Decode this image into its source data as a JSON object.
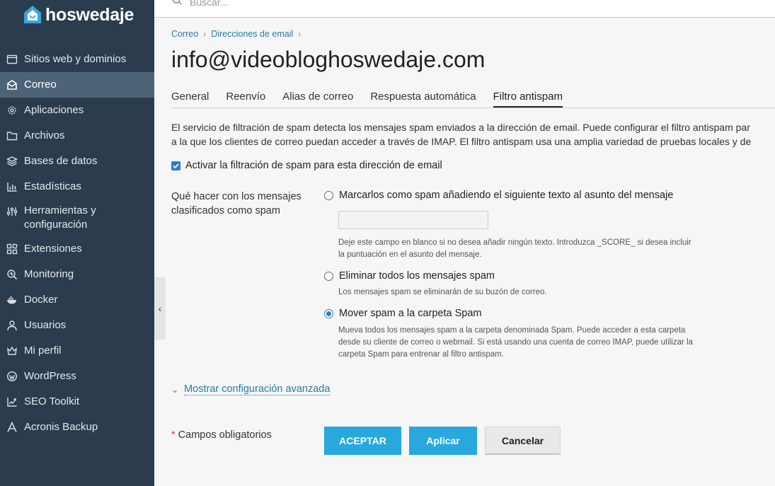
{
  "brand": {
    "name": "hoswedaje"
  },
  "search": {
    "placeholder": "Buscar..."
  },
  "sidebar": {
    "items": [
      {
        "label": "Sitios web y dominios",
        "icon": "globe-icon"
      },
      {
        "label": "Correo",
        "icon": "envelope-icon",
        "active": true
      },
      {
        "label": "Aplicaciones",
        "icon": "gear-icon"
      },
      {
        "label": "Archivos",
        "icon": "folder-icon"
      },
      {
        "label": "Bases de datos",
        "icon": "database-icon"
      },
      {
        "label": "Estadísticas",
        "icon": "bar-chart-icon"
      },
      {
        "label": "Herramientas y configuración",
        "icon": "tools-icon"
      },
      {
        "label": "Extensiones",
        "icon": "extensions-icon"
      },
      {
        "label": "Monitoring",
        "icon": "monitoring-icon"
      },
      {
        "label": "Docker",
        "icon": "docker-icon"
      },
      {
        "label": "Usuarios",
        "icon": "user-icon"
      },
      {
        "label": "Mi perfil",
        "icon": "crown-icon"
      },
      {
        "label": "WordPress",
        "icon": "wordpress-icon"
      },
      {
        "label": "SEO Toolkit",
        "icon": "seo-chart-icon"
      },
      {
        "label": "Acronis Backup",
        "icon": "acronis-icon"
      }
    ]
  },
  "breadcrumb": {
    "items": [
      "Correo",
      "Direcciones de email"
    ]
  },
  "page": {
    "title": "info@videobloghoswedaje.com"
  },
  "tabs": [
    {
      "label": "General"
    },
    {
      "label": "Reenvío"
    },
    {
      "label": "Alias de correo"
    },
    {
      "label": "Respuesta automática"
    },
    {
      "label": "Filtro antispam",
      "active": true
    }
  ],
  "description": {
    "line1": "El servicio de filtración de spam detecta los mensajes spam enviados a la dirección de email. Puede configurar el filtro antispam par",
    "line2": "a la que los clientes de correo puedan acceder a través de IMAP. El filtro antispam usa una amplia variedad de pruebas locales y de"
  },
  "enable_spam": {
    "label": "Activar la filtración de spam para esta dirección de email",
    "checked": true
  },
  "spam_action": {
    "label": "Qué hacer con los mensajes clasificados como spam",
    "options": [
      {
        "label": "Marcarlos como spam añadiendo el siguiente texto al asunto del mensaje",
        "checked": false,
        "input_value": "",
        "hint": "Deje este campo en blanco si no desea añadir ningún texto. Introduzca _SCORE_ si desea incluir la puntuación en el asunto del mensaje."
      },
      {
        "label": "Eliminar todos los mensajes spam",
        "checked": false,
        "hint": "Los mensajes spam se eliminarán de su buzón de correo."
      },
      {
        "label": "Mover spam a la carpeta Spam",
        "checked": true,
        "hint": "Mueva todos los mensajes spam a la carpeta denominada Spam. Puede acceder a esta carpeta desde su cliente de correo o webmail. Si está usando una cuenta de correo IMAP, puede utilizar la carpeta Spam para entrenar al filtro antispam."
      }
    ]
  },
  "advanced": {
    "label": "Mostrar configuración avanzada"
  },
  "form": {
    "required_star": "*",
    "required_label": "Campos obligatorios",
    "accept_label": "ACEPTAR",
    "apply_label": "Aplicar",
    "cancel_label": "Cancelar"
  },
  "colors": {
    "sidebar_bg": "#2a3c4d",
    "sidebar_active": "#4d6478",
    "accent": "#28a8dc",
    "link": "#2a7aa3"
  }
}
